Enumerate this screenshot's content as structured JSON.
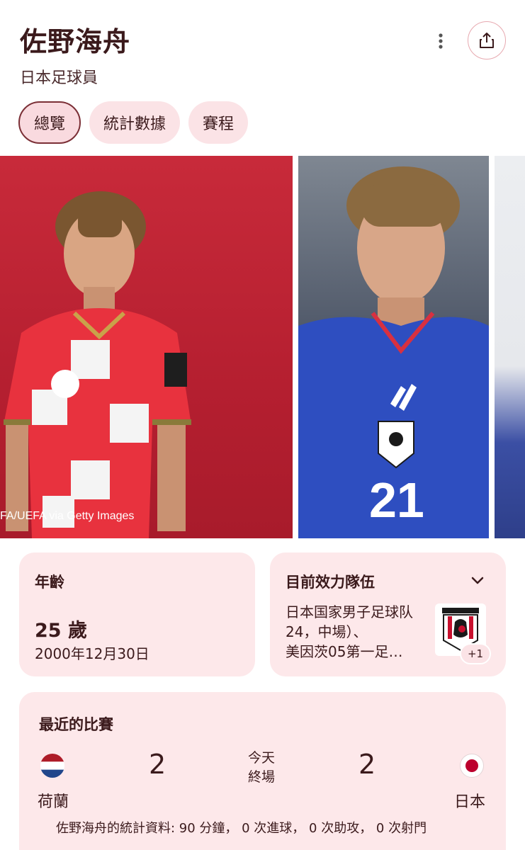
{
  "header": {
    "title": "佐野海舟",
    "subtitle": "日本足球員",
    "more_icon": "more-vert-icon",
    "share_icon": "share-icon"
  },
  "tabs": [
    {
      "label": "總覽",
      "active": true
    },
    {
      "label": "統計數據",
      "active": false
    },
    {
      "label": "賽程",
      "active": false
    }
  ],
  "gallery": {
    "credit": "FA/UEFA via Getty Images"
  },
  "age_card": {
    "label": "年齡",
    "value": "25 歲",
    "birth_date": "2000年12月30日"
  },
  "team_card": {
    "label": "目前效力隊伍",
    "lines": [
      "日本国家男子足球队",
      "24，中場）、",
      "美因茨05第一足…"
    ],
    "more_badge": "+1",
    "chevron_icon": "chevron-down-icon"
  },
  "recent_match": {
    "label": "最近的比賽",
    "home_team": "荷蘭",
    "away_team": "日本",
    "home_score": "2",
    "away_score": "2",
    "date": "今天",
    "status": "終場",
    "player_stats": "佐野海舟的統計資料: 90 分鐘， 0 次進球， 0 次助攻， 0 次射門"
  },
  "colors": {
    "accent": "#7b2f36",
    "chip_bg": "#fbe3e6",
    "card_bg": "#fde8ea",
    "text": "#3b1a1c"
  }
}
